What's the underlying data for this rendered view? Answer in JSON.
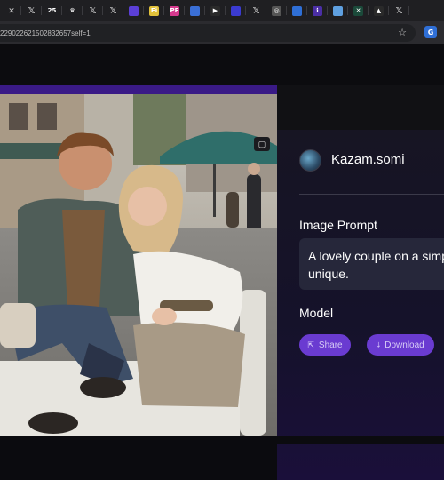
{
  "browser": {
    "tabs": [
      {
        "icon": "generic-tab-icon",
        "color": "#8a8a8a",
        "text": ""
      },
      {
        "icon": "x-icon",
        "color": "",
        "text": "𝕏"
      },
      {
        "icon": "number-25-icon",
        "color": "#1f1f22",
        "text": "25"
      },
      {
        "icon": "crown-icon",
        "color": "#1f1f22",
        "text": "♛"
      },
      {
        "icon": "x-icon",
        "color": "",
        "text": "𝕏"
      },
      {
        "icon": "x-icon",
        "color": "",
        "text": "𝕏"
      },
      {
        "icon": "circle-logo-icon",
        "color": "#5b3fd6",
        "text": ""
      },
      {
        "icon": "fi-icon",
        "color": "#e2c23a",
        "text": "Fi"
      },
      {
        "icon": "pe-icon",
        "color": "#d63a8f",
        "text": "PE"
      },
      {
        "icon": "swirl-icon",
        "color": "#3a6fd6",
        "text": ""
      },
      {
        "icon": "ai-icon",
        "color": "#2a2a2a",
        "text": "▶"
      },
      {
        "icon": "orbit-icon",
        "color": "#3b3bd1",
        "text": ""
      },
      {
        "icon": "x-icon",
        "color": "",
        "text": "𝕏"
      },
      {
        "icon": "globe-icon",
        "color": "#555",
        "text": "◎"
      },
      {
        "icon": "blue-app-icon",
        "color": "#2f6fd6",
        "text": ""
      },
      {
        "icon": "purple-app-icon",
        "color": "#4b2fa6",
        "text": "ℹ"
      },
      {
        "icon": "image-tab-icon",
        "color": "#5fa0e0",
        "text": ""
      },
      {
        "icon": "green-x-icon",
        "color": "#1b4a3a",
        "text": "✕"
      },
      {
        "icon": "triangle-icon",
        "color": "#2a2a2a",
        "text": "▲"
      },
      {
        "icon": "x-icon",
        "color": "",
        "text": "𝕏"
      }
    ],
    "active_tab_close": "✕",
    "url": "229022621502832657self=1",
    "star_icon": "☆",
    "extension_label": "G"
  },
  "panel": {
    "username": "Kazam.somi",
    "image_prompt_label": "Image Prompt",
    "prompt_text_line1": "A lovely couple on a simp",
    "prompt_text_line2": "unique.",
    "model_label": "Model",
    "share_label": "Share",
    "download_label": "Download"
  },
  "colors": {
    "accent_button": "#6a3bd1",
    "purple_bar": "#3a1a86",
    "prompt_box": "#26273a"
  }
}
